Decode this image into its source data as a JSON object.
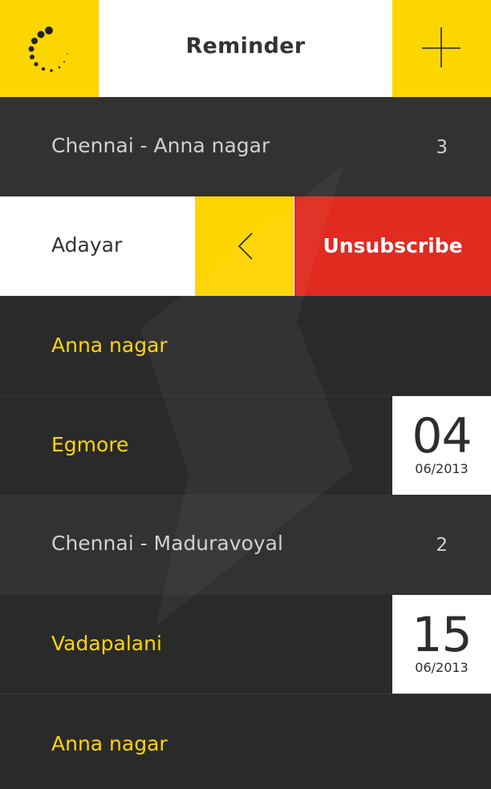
{
  "header": {
    "title": "Reminder",
    "left_icon": "loading-spinner-icon",
    "right_icon": "plus-icon",
    "accent_color": "#fdd600"
  },
  "rows": [
    {
      "kind": "group",
      "label": "Chennai - Anna nagar",
      "count": "3"
    },
    {
      "kind": "swiped",
      "label": "Adayar",
      "back_icon": "chevron-left-icon",
      "action_label": "Unsubscribe",
      "action_color": "#e02b20"
    },
    {
      "kind": "item",
      "label": "Anna nagar"
    },
    {
      "kind": "item",
      "label": "Egmore",
      "date": {
        "day": "04",
        "month_year": "06/2013"
      }
    },
    {
      "kind": "group",
      "label": "Chennai - Maduravoyal",
      "count": "2"
    },
    {
      "kind": "item",
      "label": "Vadapalani",
      "date": {
        "day": "15",
        "month_year": "06/2013"
      }
    },
    {
      "kind": "item",
      "label": "Anna nagar"
    }
  ]
}
